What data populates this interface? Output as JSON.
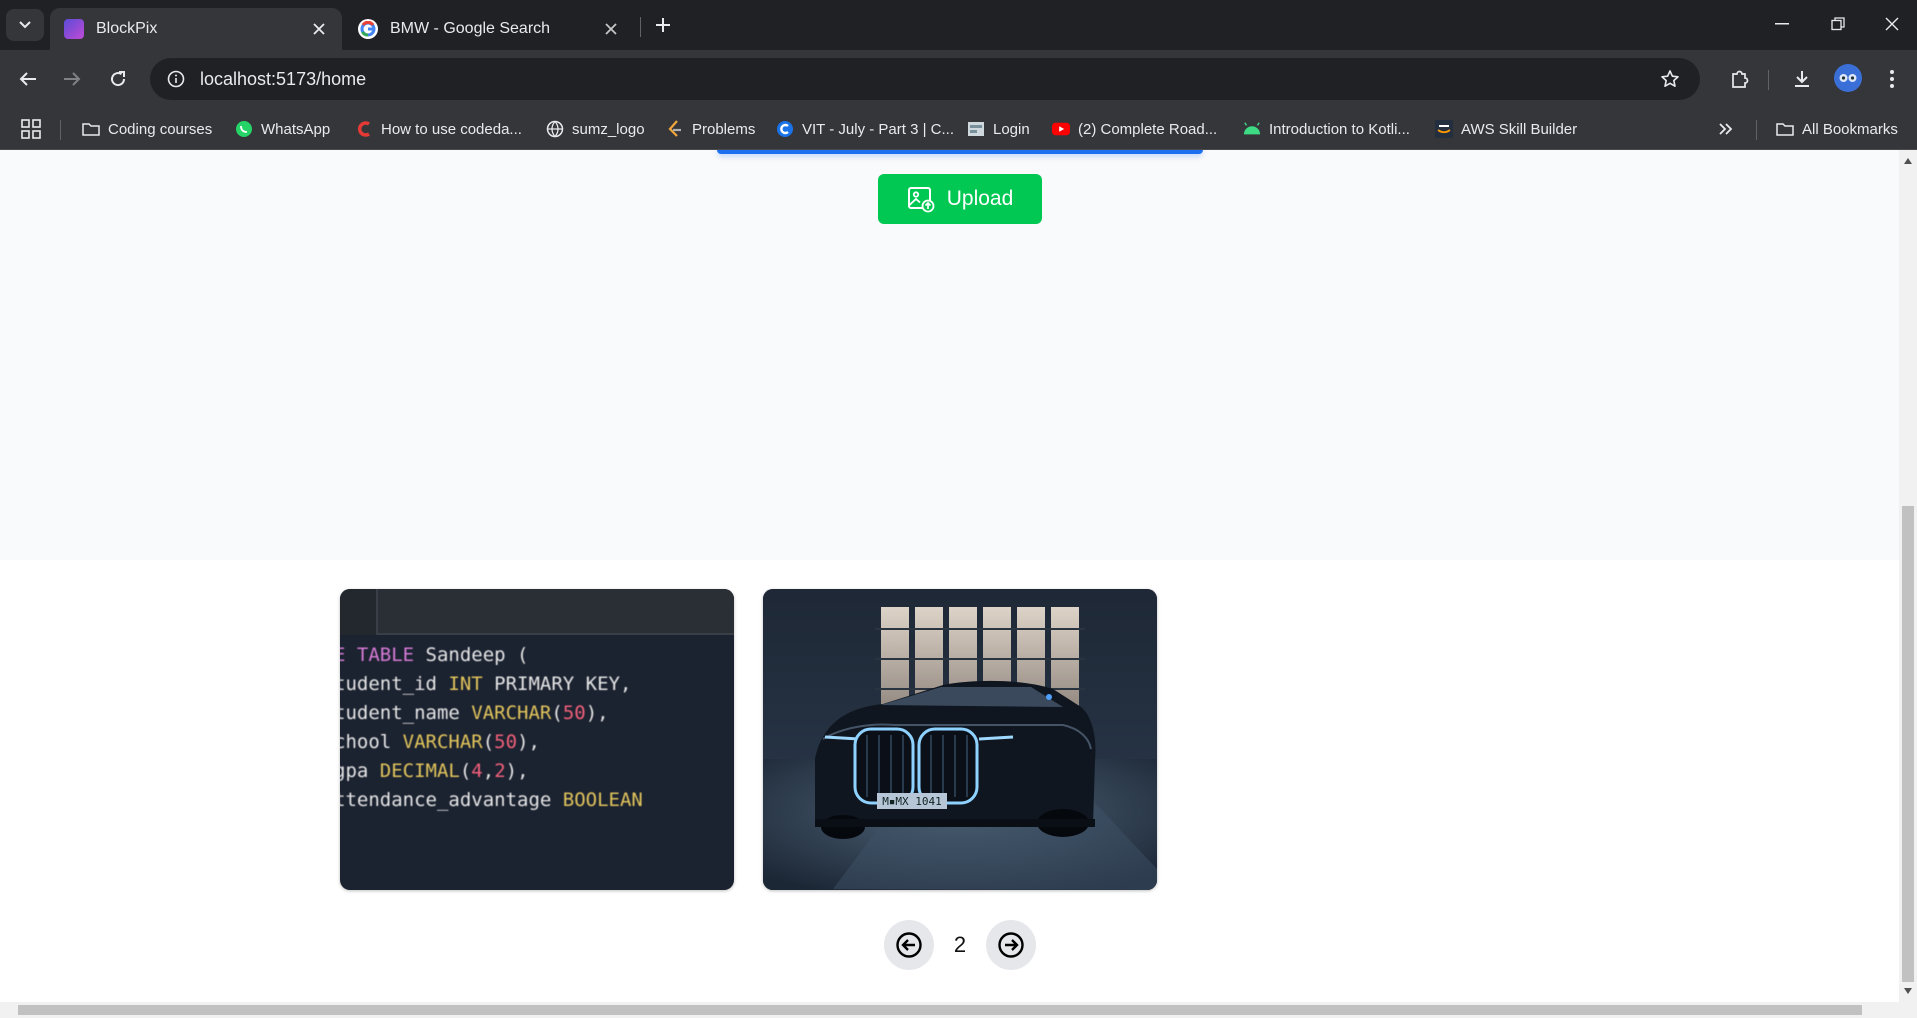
{
  "tabs": [
    {
      "title": "BlockPix",
      "active": true
    },
    {
      "title": "BMW - Google Search",
      "active": false
    }
  ],
  "address_bar": {
    "url": "localhost:5173/home"
  },
  "bookmarks": [
    {
      "label": "Coding courses",
      "icon": "folder-icon"
    },
    {
      "label": "WhatsApp",
      "icon": "whatsapp-icon"
    },
    {
      "label": "How to use codeda...",
      "icon": "codedamn-icon"
    },
    {
      "label": "sumz_logo",
      "icon": "globe-icon"
    },
    {
      "label": "Problems",
      "icon": "leetcode-icon"
    },
    {
      "label": "VIT - July - Part 3 | C...",
      "icon": "coursera-icon"
    },
    {
      "label": "Login",
      "icon": "login-icon"
    },
    {
      "label": "(2) Complete Road...",
      "icon": "youtube-icon"
    },
    {
      "label": "Introduction to Kotli...",
      "icon": "android-icon"
    },
    {
      "label": "AWS Skill Builder",
      "icon": "aws-icon"
    }
  ],
  "all_bookmarks_label": "All Bookmarks",
  "upload": {
    "label": "Upload"
  },
  "code_image": {
    "lines": [
      "E TABLE Sandeep (",
      "tudent_id INT PRIMARY KEY,",
      "tudent_name VARCHAR(50),",
      "chool VARCHAR(50),",
      "gpa DECIMAL(4,2),",
      "ttendance_advantage BOOLEAN"
    ],
    "plate": "M▪MX 1041"
  },
  "pagination": {
    "current_page": "2"
  },
  "colors": {
    "upload_green": "#00c853",
    "accent_blue": "#1d6ff2",
    "chrome_dark": "#202124"
  }
}
